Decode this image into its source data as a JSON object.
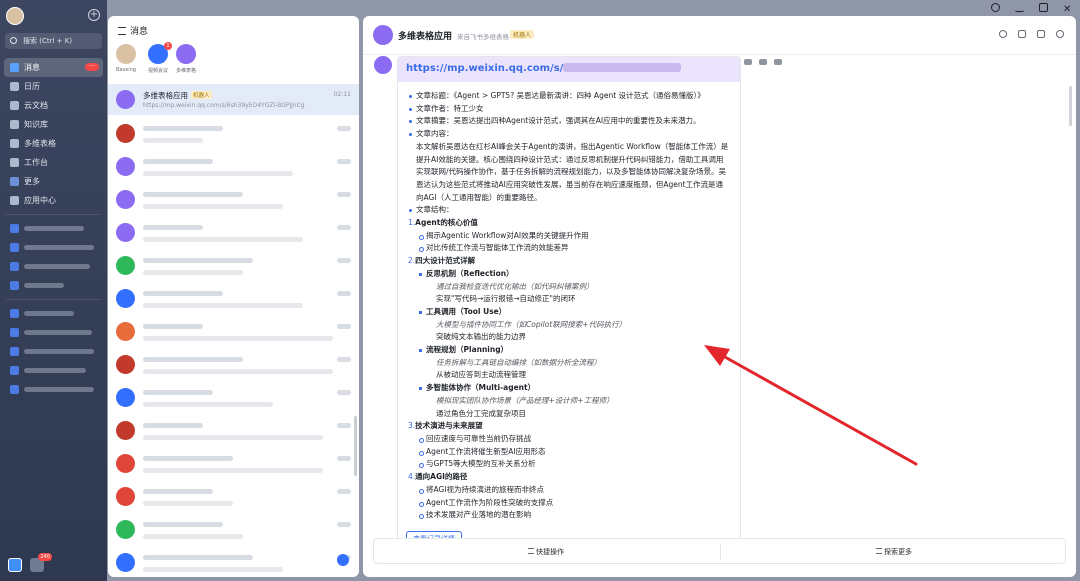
{
  "nav": {
    "search_label": "搜索 (Ctrl + K)",
    "items": [
      {
        "label": "消息",
        "badge": "···"
      },
      {
        "label": "日历"
      },
      {
        "label": "云文档"
      },
      {
        "label": "知识库"
      },
      {
        "label": "多维表格"
      },
      {
        "label": "工作台"
      },
      {
        "label": "更多"
      },
      {
        "label": "应用中心"
      }
    ],
    "dock_badge": "240"
  },
  "list": {
    "header": "消息",
    "pinned": [
      {
        "label": "Baoxing",
        "color": "#d9c2a4"
      },
      {
        "label": "视频会议",
        "color": "#3370ff",
        "badge": "1"
      },
      {
        "label": "多维表格",
        "color": "#8a6bf2"
      }
    ],
    "selected_chat": {
      "name": "多维表格应用",
      "tag": "机器人",
      "time": "02:11",
      "preview": "https://mp.weixin.qq.com/s/6sh39yEO4YGZl-BGPjJnCg"
    }
  },
  "main": {
    "title": "多维表格应用",
    "subtitle": "来自飞书多维表格",
    "tag": "机器人",
    "card": {
      "url_visible": "https://mp.weixin.qq.com/s/",
      "lines": [
        {
          "k": "b",
          "t": "文章标题：《Agent > GPT5? 吴恩达最新演讲：四种 Agent 设计范式（通俗易懂版）》"
        },
        {
          "k": "b",
          "t": "文章作者：特工少女"
        },
        {
          "k": "b",
          "t": "文章摘要：吴恩达提出四种Agent设计范式，强调其在AI应用中的重要性及未来潜力。"
        },
        {
          "k": "b",
          "t": "文章内容："
        },
        {
          "k": "para",
          "t": "本文解析吴恩达在红杉AI峰会关于Agent的演讲，指出Agentic Workflow（智能体工作流）是提升AI效能的关键。核心围绕四种设计范式：通过反思机制提升代码纠错能力，借助工具调用实现联网/代码操作协作，基于任务拆解的流程规划能力，以及多智能体协同解决复杂场景。吴恩达认为这些范式将推动AI应用突破性发展，虽当前存在响应速度瓶颈，但Agent工作流是通向AGI（人工通用智能）的重要路径。"
        },
        {
          "k": "b",
          "t": "文章结构："
        },
        {
          "k": "h",
          "n": "1.",
          "t": "Agent的核心价值"
        },
        {
          "k": "sb",
          "t": "揭示Agentic Workflow对AI效果的关键提升作用"
        },
        {
          "k": "sb",
          "t": "对比传统工作流与智能体工作流的效能差异"
        },
        {
          "k": "h",
          "n": "2.",
          "t": "四大设计范式详解"
        },
        {
          "k": "ssb",
          "t": "反思机制（Reflection）"
        },
        {
          "k": "it",
          "t": "通过自我检查迭代优化输出（如代码纠错案例）"
        },
        {
          "k": "pl",
          "t": "实现\"写代码→运行报错→自动修正\"的闭环"
        },
        {
          "k": "ssb",
          "t": "工具调用（Tool Use）"
        },
        {
          "k": "it",
          "t": "大模型与插件协同工作（如Copilot联网搜索+代码执行）"
        },
        {
          "k": "pl",
          "t": "突破纯文本输出的能力边界"
        },
        {
          "k": "ssb",
          "t": "流程规划（Planning）"
        },
        {
          "k": "it",
          "t": "任务拆解与工具链自动编排（如数据分析全流程）"
        },
        {
          "k": "pl",
          "t": "从被动应答到主动流程管理"
        },
        {
          "k": "ssb",
          "t": "多智能体协作（Multi-agent）"
        },
        {
          "k": "it",
          "t": "模拟现实团队协作场景（产品经理+设计师+工程师）"
        },
        {
          "k": "pl",
          "t": "通过角色分工完成复杂项目"
        },
        {
          "k": "h",
          "n": "3.",
          "t": "技术演进与未来展望"
        },
        {
          "k": "sb",
          "t": "回应速度与可靠性当前仍存挑战"
        },
        {
          "k": "sb",
          "t": "Agent工作流将催生新型AI应用形态"
        },
        {
          "k": "sb",
          "t": "与GPT5等大模型的互补关系分析"
        },
        {
          "k": "h",
          "n": "4.",
          "t": "通向AGI的路径"
        },
        {
          "k": "sb",
          "t": "将AGI视为持续演进的旅程而非终点"
        },
        {
          "k": "sb",
          "t": "Agent工作流作为阶段性突破的支撑点"
        },
        {
          "k": "sb",
          "t": "技术发展对产业落地的潜在影响"
        }
      ],
      "more_button": "查看记录详情"
    },
    "bottom": {
      "quick_action": "快捷操作",
      "explore": "探索更多"
    }
  },
  "colors": {
    "accent": "#3370ff",
    "bot": "#8a6bf2",
    "annotation_arrow": "#e3262b"
  }
}
